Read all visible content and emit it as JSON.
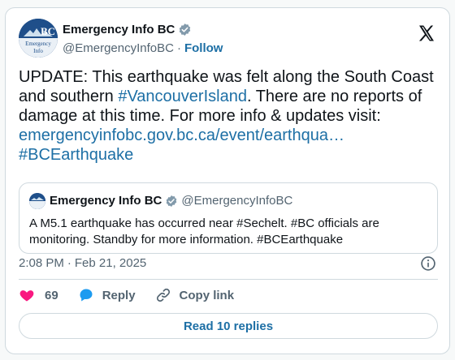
{
  "author": {
    "display_name": "Emergency Info BC",
    "handle": "@EmergencyInfoBC",
    "follow_label": "Follow",
    "separator": "·",
    "avatar_text": "BC",
    "avatar_subtext_1": "Emergency",
    "avatar_subtext_2": "Info"
  },
  "tweet": {
    "text_part1": "UPDATE: This earthquake was felt along the South Coast and southern ",
    "hashtag1": "#VancouverIsland",
    "text_part2": ". There are no reports of damage at this time. For more info & updates visit: ",
    "url": "emergencyinfobc.gov.bc.ca/event/earthqua…",
    "hashtag2": "#BCEarthquake"
  },
  "quoted": {
    "display_name": "Emergency Info BC",
    "handle": "@EmergencyInfoBC",
    "text": "A M5.1 earthquake has occurred near #Sechelt. #BC officials are monitoring. Standby for more information. #BCEarthquake"
  },
  "meta": {
    "time": "2:08 PM",
    "separator": "·",
    "date": "Feb 21, 2025"
  },
  "actions": {
    "like_count": "69",
    "reply_label": "Reply",
    "copy_link_label": "Copy link"
  },
  "read_replies_label": "Read 10 replies",
  "colors": {
    "link": "#1d6fa5",
    "heart": "#f91880",
    "verified": "#829aab",
    "avatar_bg": "#1f4f8a"
  }
}
